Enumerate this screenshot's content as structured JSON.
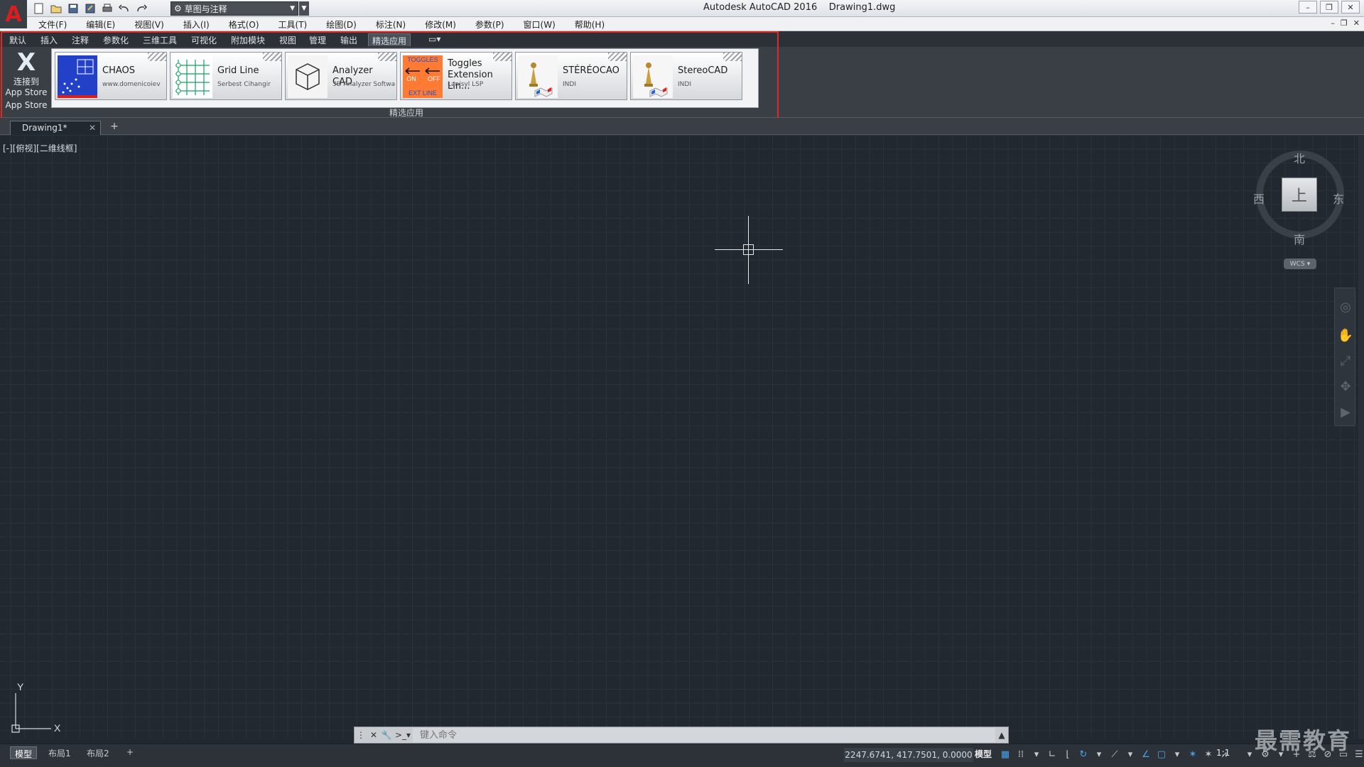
{
  "app": {
    "title": "Autodesk AutoCAD 2016",
    "file": "Drawing1.dwg"
  },
  "qat": {
    "workspace": "草图与注释"
  },
  "menu": [
    "文件(F)",
    "编辑(E)",
    "视图(V)",
    "插入(I)",
    "格式(O)",
    "工具(T)",
    "绘图(D)",
    "标注(N)",
    "修改(M)",
    "参数(P)",
    "窗口(W)",
    "帮助(H)"
  ],
  "ribbon_tabs": [
    "默认",
    "插入",
    "注释",
    "参数化",
    "三维工具",
    "可视化",
    "附加模块",
    "视图",
    "管理",
    "输出",
    "精选应用"
  ],
  "selected_ribbon_tab": "精选应用",
  "connect": {
    "line1": "连接到",
    "line2": "App Store",
    "line3": "App Store"
  },
  "apps": [
    {
      "name": "CHAOS",
      "author": "www.domenicoiev"
    },
    {
      "name": "Grid Line",
      "author": "Serbest Cihangir"
    },
    {
      "name": "Analyzer CAD",
      "author": "3D Analyzer Softwa"
    },
    {
      "name": "Toggles Extension Lin...",
      "author": "Lanisyl LSP",
      "icon_text": {
        "top": "TOGGLES",
        "on": "ON",
        "off": "OFF",
        "bottom": "EXT LINE"
      }
    },
    {
      "name": "STÉRÉOCAO",
      "author": "INDI"
    },
    {
      "name": "StereoCAD",
      "author": "INDI"
    }
  ],
  "panel_title": "精选应用",
  "document_tab": "Drawing1*",
  "viewport_label": "[-][俯视][二维线框]",
  "viewcube": {
    "north": "北",
    "south": "南",
    "east": "东",
    "west": "西",
    "face": "上",
    "wcs": "WCS"
  },
  "ucs": {
    "x": "X",
    "y": "Y"
  },
  "command": {
    "placeholder": "键入命令"
  },
  "layout_tabs": [
    "模型",
    "布局1",
    "布局2"
  ],
  "status": {
    "coords": "2247.6741, 417.7501, 0.0000",
    "model": "模型",
    "scale": "1:1"
  },
  "watermark": "最需教育",
  "colors": {
    "accent_red": "#e02828",
    "background": "#212830",
    "ribbon": "#3a3f46"
  }
}
